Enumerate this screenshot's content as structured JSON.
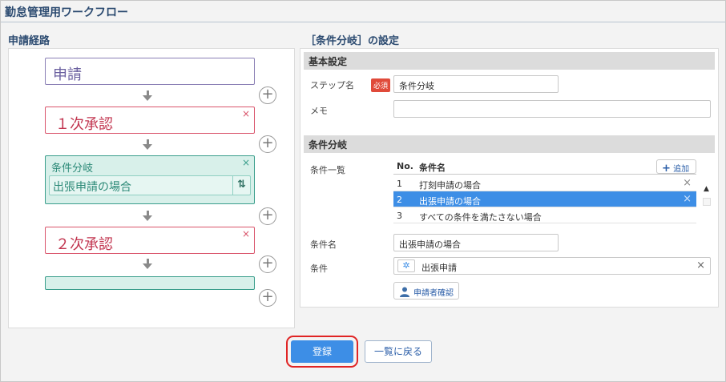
{
  "page": {
    "title": "勤怠管理用ワークフロー"
  },
  "left": {
    "heading": "申請経路",
    "apply_label": "申請",
    "step1_label": "１次承認",
    "branch": {
      "title": "条件分岐",
      "selected_condition": "出張申請の場合"
    },
    "step2_label": "２次承認",
    "close_glyph": "×",
    "swap_glyph": "⇅",
    "add_glyph": "+"
  },
  "right": {
    "heading": "［条件分岐］の設定",
    "basic": {
      "title": "基本設定",
      "step_name_label": "ステップ名",
      "required_badge": "必須",
      "step_name_value": "条件分岐",
      "memo_label": "メモ",
      "memo_value": ""
    },
    "branch": {
      "title": "条件分岐",
      "list_label": "条件一覧",
      "col_no": "No.",
      "col_name": "条件名",
      "add_button": "追加",
      "rows": [
        {
          "no": "1",
          "name": "打刻申請の場合"
        },
        {
          "no": "2",
          "name": "出張申請の場合"
        },
        {
          "no": "3",
          "name": "すべての条件を満たさない場合"
        }
      ],
      "cond_name_label": "条件名",
      "cond_name_value": "出張申請の場合",
      "cond_label": "条件",
      "cond_value": "出張申請",
      "confirm_button": "申請者確認",
      "row_remove_glyph": "×",
      "up_glyph": "▲"
    }
  },
  "footer": {
    "register_button": "登録",
    "back_button": "一覧に戻る"
  },
  "colors": {
    "accent": "#3d8ee6",
    "approve": "#d9546b",
    "branch": "#3a9e8c",
    "apply": "#8a7fb5",
    "highlight": "#e02424"
  }
}
